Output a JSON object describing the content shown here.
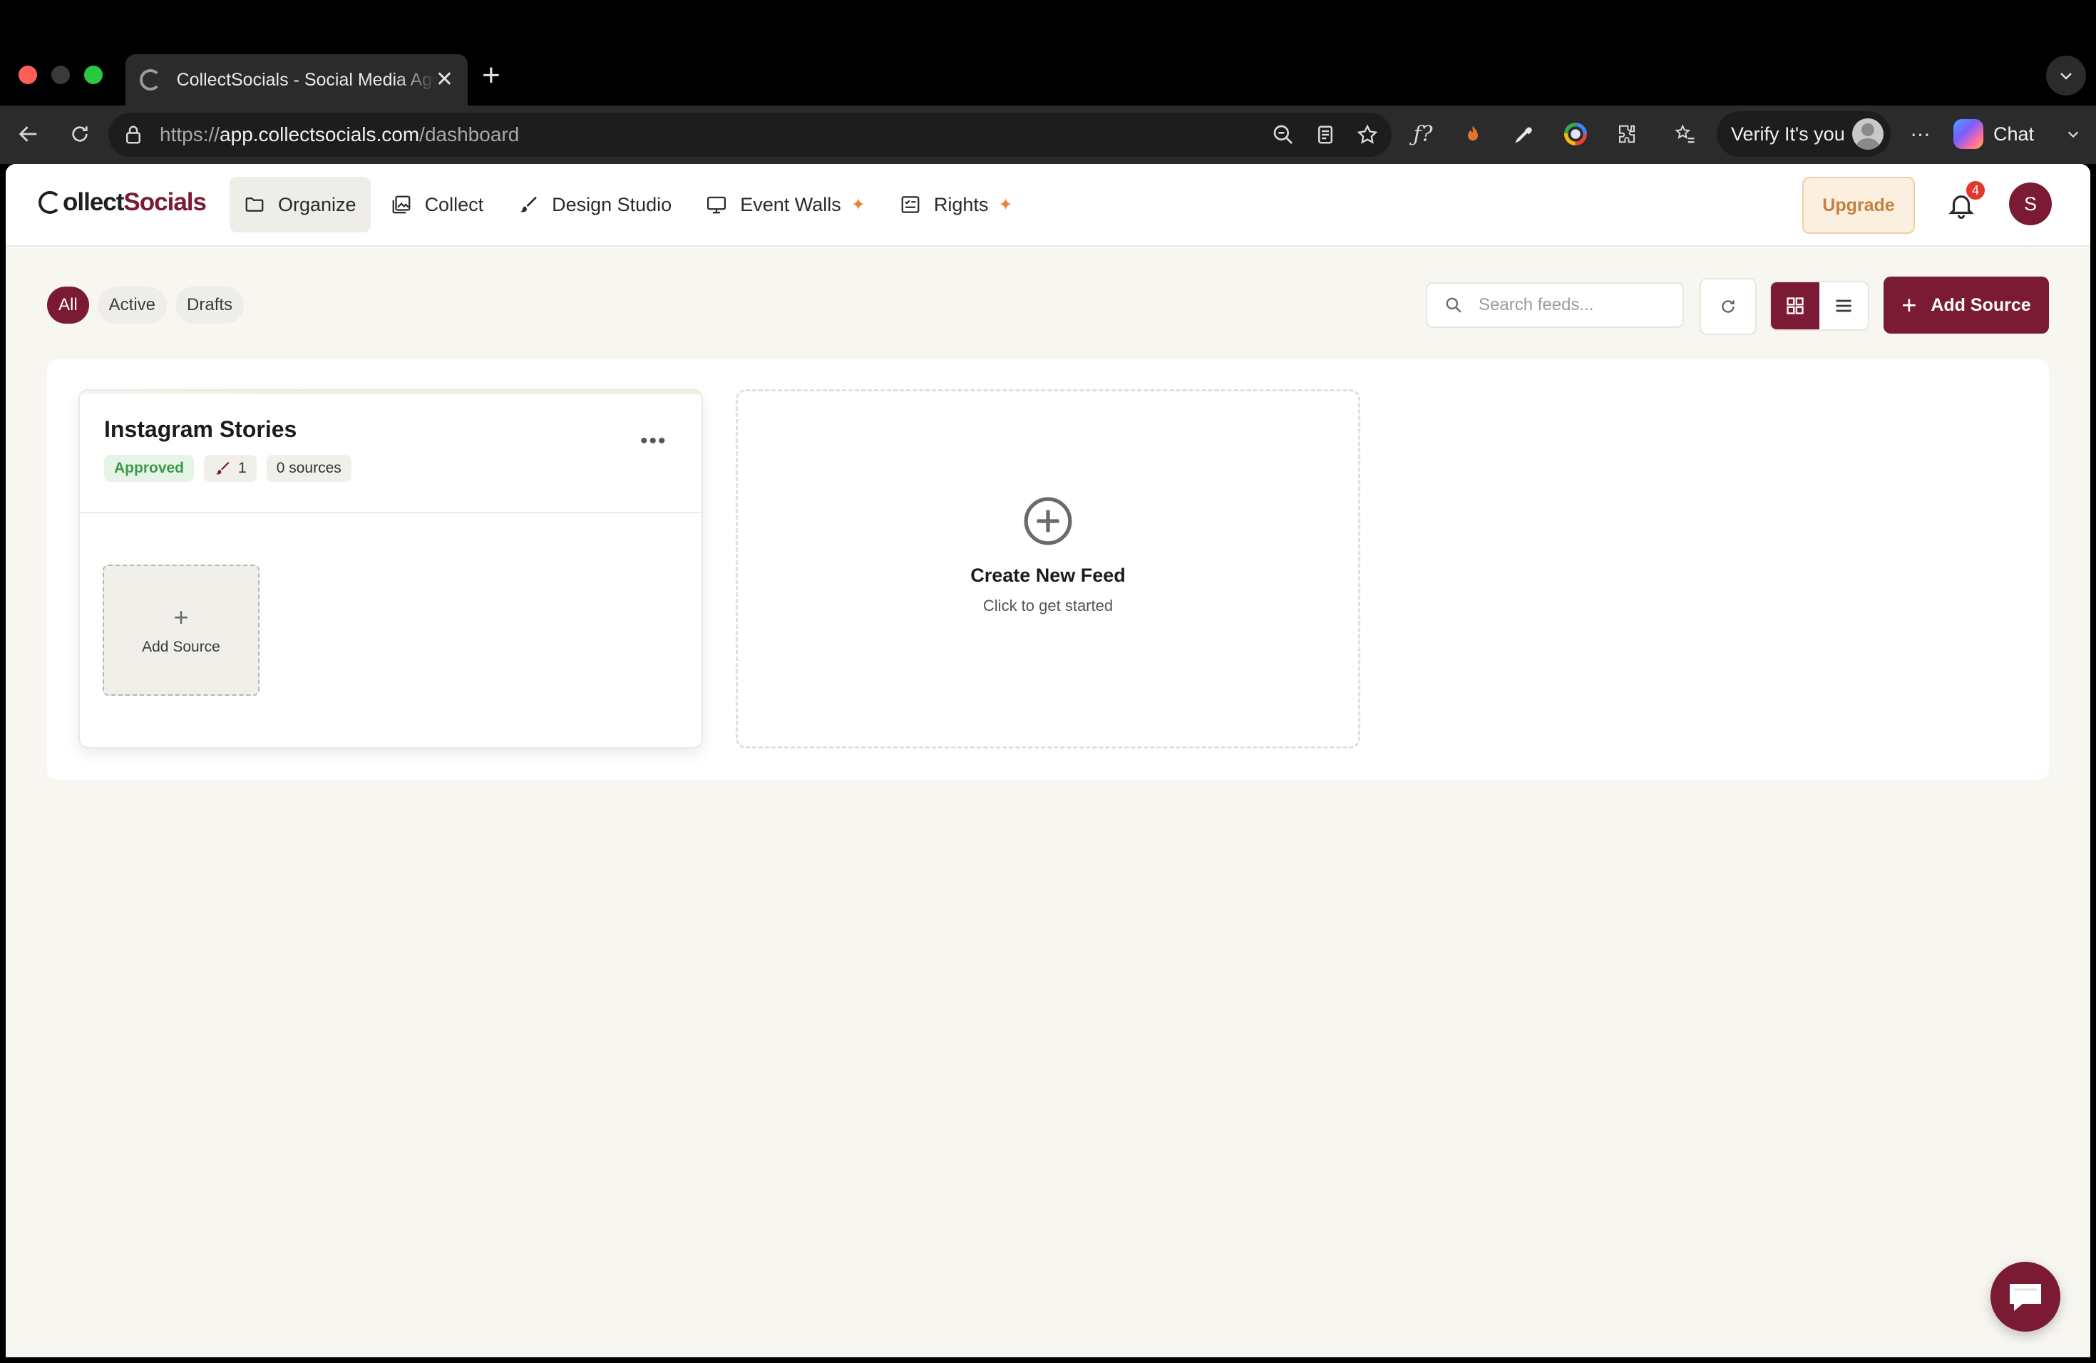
{
  "browser": {
    "tab_title": "CollectSocials - Social Media Aggregator",
    "url_scheme": "https://",
    "url_host": "app.collectsocials.com",
    "url_path": "/dashboard",
    "verify_label": "Verify It's you",
    "chat_label": "Chat",
    "new_tab_glyph": "+",
    "close_glyph": "✕"
  },
  "brand": {
    "logo_plain": "ollect",
    "logo_accent": "Socials",
    "accent_color": "#7b1a33"
  },
  "nav": {
    "items": [
      {
        "label": "Organize",
        "icon": "folder-icon",
        "active": true
      },
      {
        "label": "Collect",
        "icon": "image-gallery-icon"
      },
      {
        "label": "Design Studio",
        "icon": "brush-icon"
      },
      {
        "label": "Event Walls",
        "icon": "monitor-icon",
        "sparkle": true
      },
      {
        "label": "Rights",
        "icon": "rights-doc-icon",
        "sparkle": true
      }
    ],
    "sparkle_glyph": "✦"
  },
  "header": {
    "upgrade_label": "Upgrade",
    "notification_count": "4",
    "avatar_initial": "S"
  },
  "filters": {
    "chips": [
      "All",
      "Active",
      "Drafts"
    ],
    "active": "All"
  },
  "controls": {
    "search_placeholder": "Search feeds...",
    "add_source_label": "Add Source",
    "view_mode": "grid"
  },
  "feeds": [
    {
      "title": "Instagram Stories",
      "status": "Approved",
      "edit_count": "1",
      "sources_label": "0 sources",
      "menu_glyph": "•••",
      "add_tile_label": "Add Source"
    }
  ],
  "new_feed": {
    "title": "Create New Feed",
    "subtitle": "Click to get started"
  }
}
